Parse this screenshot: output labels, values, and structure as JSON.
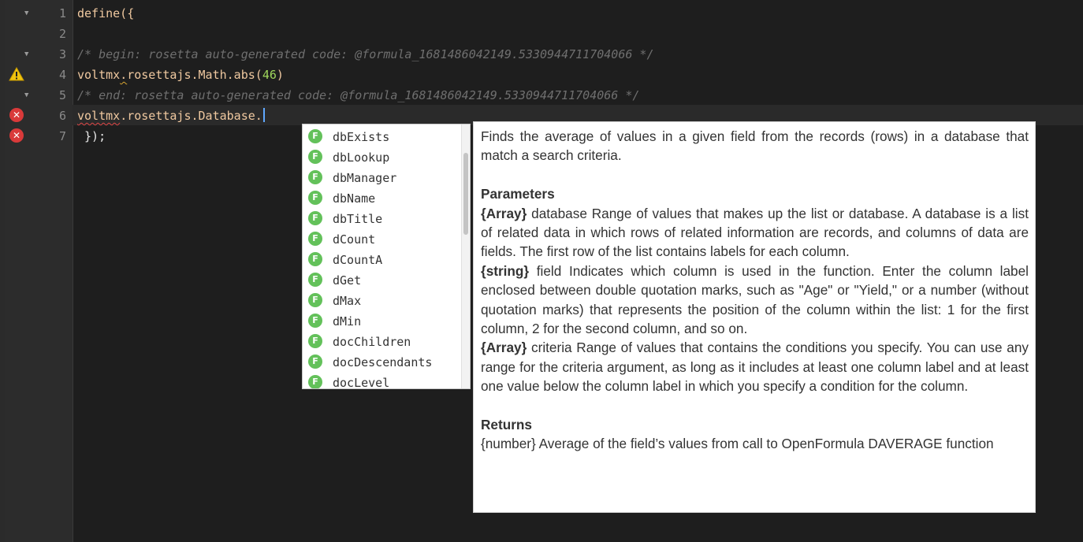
{
  "gutter": {
    "lines": [
      {
        "num": "1",
        "fold": true,
        "marker": ""
      },
      {
        "num": "2",
        "fold": false,
        "marker": ""
      },
      {
        "num": "3",
        "fold": true,
        "marker": ""
      },
      {
        "num": "4",
        "fold": false,
        "marker": "warning"
      },
      {
        "num": "5",
        "fold": true,
        "marker": ""
      },
      {
        "num": "6",
        "fold": false,
        "marker": "error"
      },
      {
        "num": "7",
        "fold": false,
        "marker": "error"
      }
    ],
    "fold_glyph": "▼",
    "error_glyph": "✕",
    "warning_glyph": "!"
  },
  "code": {
    "line1": "define({",
    "line3": "/* begin: rosetta auto-generated code: @formula_1681486042149.5330944711704066 */",
    "line4": {
      "obj": "voltmx",
      "dot1": ".",
      "rest": "rosettajs.Math.abs(",
      "arg": "46",
      "close": ")"
    },
    "line5": "/* end: rosetta auto-generated code: @formula_1681486042149.5330944711704066 */",
    "line6": {
      "obj": "voltmx",
      "rest": ".rosettajs.Database."
    },
    "line7": " });"
  },
  "suggestions": {
    "icon_letter": "F",
    "items": [
      "dbExists",
      "dbLookup",
      "dbManager",
      "dbName",
      "dbTitle",
      "dCount",
      "dCountA",
      "dGet",
      "dMax",
      "dMin",
      "docChildren",
      "docDescendants",
      "docLevel"
    ]
  },
  "doc": {
    "summary": "Finds the average of values in a given field from the records (rows) in a database that match a search criteria.",
    "parameters_heading": "Parameters",
    "params": [
      {
        "type": "{Array}",
        "text": " database Range of values that makes up the list or database. A database is a list of related data in which rows of related information are records, and columns of data are fields. The first row of the list contains labels for each column."
      },
      {
        "type": "{string}",
        "text": " field Indicates which column is used in the function. Enter the column label enclosed between double quotation marks, such as \"Age\" or \"Yield,\" or a number (without quotation marks) that represents the position of the column within the list: 1 for the first column, 2 for the second column, and so on."
      },
      {
        "type": "{Array}",
        "text": " criteria Range of values that contains the conditions you specify. You can use any range for the criteria argument, as long as it includes at least one column label and at least one value below the column label in which you specify a condition for the column."
      }
    ],
    "returns_heading": "Returns",
    "returns": "{number} Average of the field’s values from call to OpenFormula DAVERAGE function"
  },
  "colors": {
    "background": "#1e1e1e",
    "gutter": "#2c2c2c",
    "identifier": "#f0c9a0",
    "number": "#9fd65c",
    "comment": "#6f6f6f",
    "error": "#d93a3a",
    "warning": "#f1c40f",
    "function_icon": "#63c15a"
  }
}
